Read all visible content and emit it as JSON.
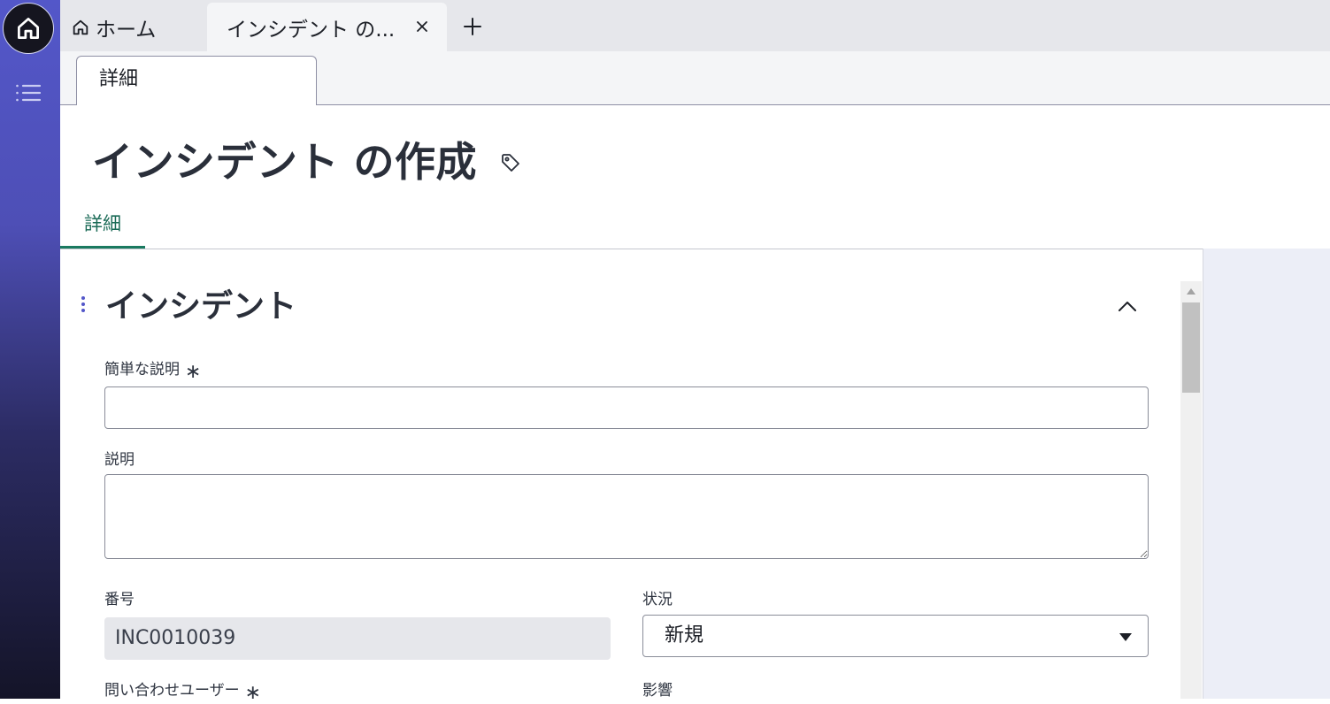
{
  "tabs": {
    "home_label": "ホーム",
    "incident_label": "インシデント の..."
  },
  "subtab": {
    "label": "詳細"
  },
  "page": {
    "title": "インシデント の作成"
  },
  "content_tabs": {
    "details_label": "詳細"
  },
  "section": {
    "title": "インシデント"
  },
  "fields": {
    "short_description": {
      "label": "簡単な説明",
      "required": "∗",
      "value": ""
    },
    "description": {
      "label": "説明",
      "value": ""
    },
    "number": {
      "label": "番号",
      "value": "INC0010039"
    },
    "state": {
      "label": "状況",
      "value": "新規"
    },
    "caller": {
      "label": "問い合わせユーザー",
      "required": "∗"
    },
    "impact": {
      "label": "影響"
    }
  },
  "colors": {
    "rail_top": "#5357c9",
    "rail_bottom": "#141428",
    "active_tab_accent": "#1a7a60"
  },
  "icons": {
    "home_rail": "home-icon",
    "menu": "list-icon",
    "home_tab": "home-icon",
    "close": "close-icon",
    "add": "plus-icon",
    "tag": "tag-icon",
    "drag": "drag-handle-icon",
    "collapse": "chevron-up-icon",
    "dropdown": "caret-down-icon"
  }
}
